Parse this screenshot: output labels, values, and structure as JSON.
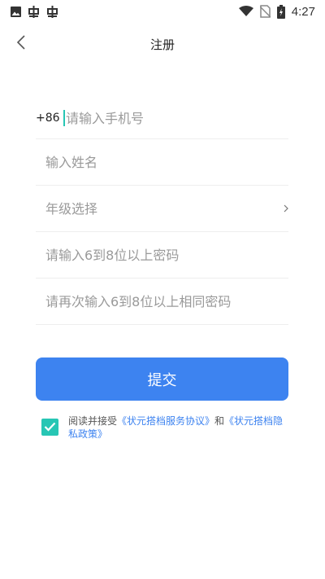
{
  "status_bar": {
    "time": "4:27",
    "left_icons": [
      "image-icon",
      "bug-icon",
      "bug-icon"
    ],
    "right_icons": [
      "wifi-icon",
      "no-sim-icon",
      "battery-icon"
    ]
  },
  "nav": {
    "title": "注册",
    "back_icon": "chevron-left-icon"
  },
  "form": {
    "phone_prefix": "+86",
    "phone_placeholder": "请输入手机号",
    "name_placeholder": "输入姓名",
    "grade_placeholder": "年级选择",
    "password_placeholder": "请输入6到8位以上密码",
    "confirm_placeholder": "请再次输入6到8位以上相同密码"
  },
  "submit_label": "提交",
  "agreement": {
    "checked": true,
    "text_prefix": "阅读并接受",
    "service_link": "《状元搭档服务协议》",
    "conjunction": "和",
    "privacy_link": "《状元搭档隐私政策》"
  },
  "colors": {
    "accent": "#3d83f0",
    "check": "#27c6b4"
  }
}
